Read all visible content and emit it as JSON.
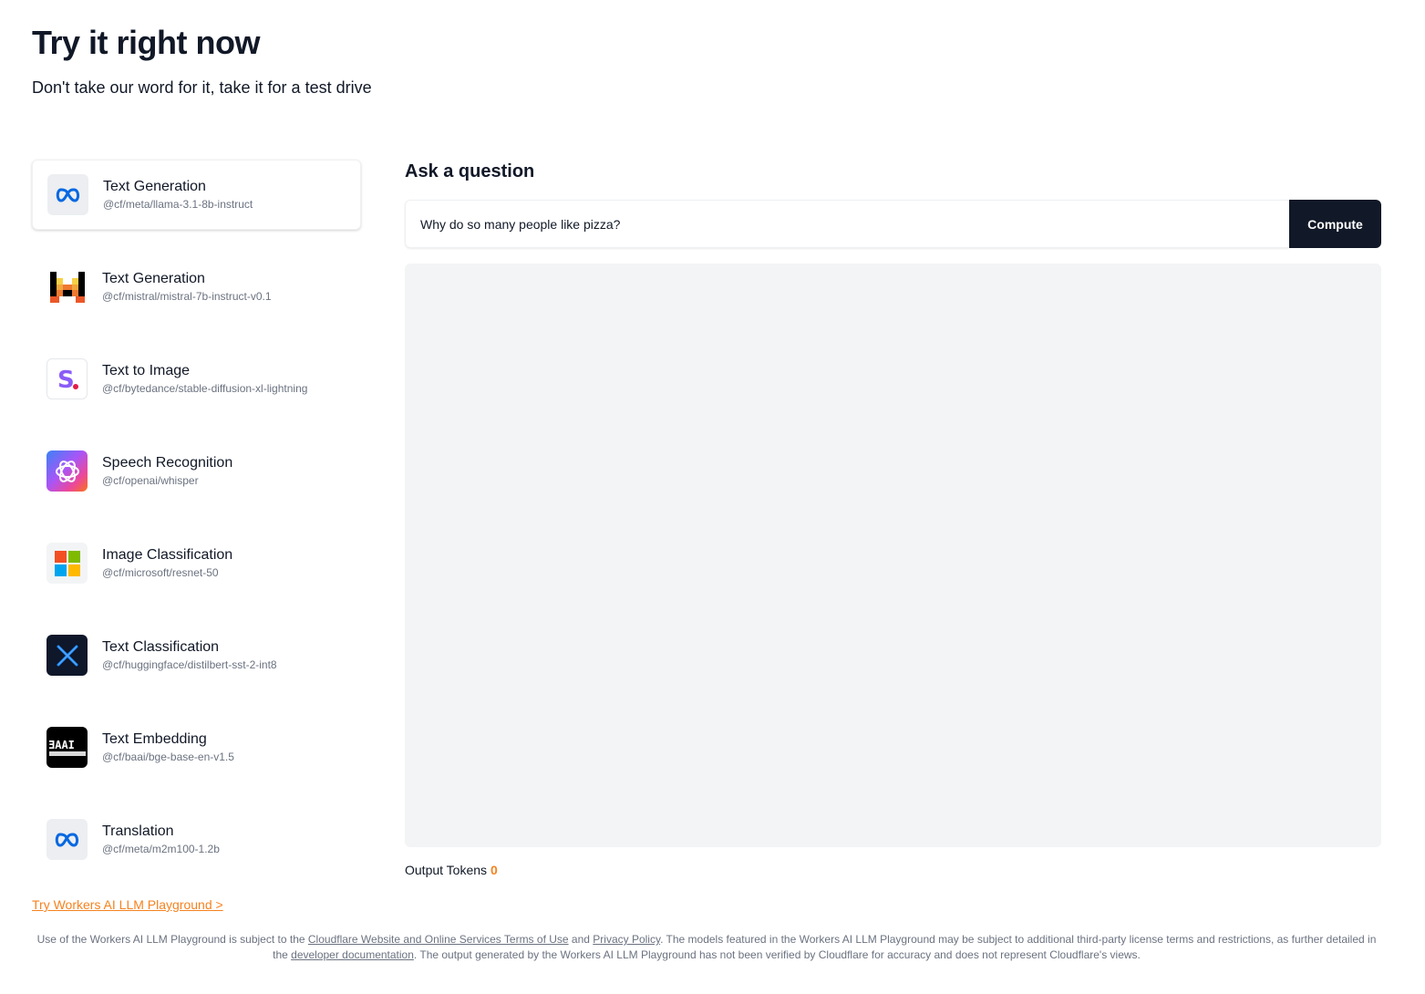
{
  "header": {
    "title": "Try it right now",
    "subtitle": "Don't take our word for it, take it for a test drive"
  },
  "models": [
    {
      "name": "Text Generation",
      "id": "@cf/meta/llama-3.1-8b-instruct",
      "icon": "meta-icon",
      "active": true
    },
    {
      "name": "Text Generation",
      "id": "@cf/mistral/mistral-7b-instruct-v0.1",
      "icon": "mistral-icon",
      "active": false
    },
    {
      "name": "Text to Image",
      "id": "@cf/bytedance/stable-diffusion-xl-lightning",
      "icon": "stability-icon",
      "active": false
    },
    {
      "name": "Speech Recognition",
      "id": "@cf/openai/whisper",
      "icon": "openai-icon",
      "active": false
    },
    {
      "name": "Image Classification",
      "id": "@cf/microsoft/resnet-50",
      "icon": "microsoft-icon",
      "active": false
    },
    {
      "name": "Text Classification",
      "id": "@cf/huggingface/distilbert-sst-2-int8",
      "icon": "huggingface-x-icon",
      "active": false
    },
    {
      "name": "Text Embedding",
      "id": "@cf/baai/bge-base-en-v1.5",
      "icon": "baai-icon",
      "active": false
    },
    {
      "name": "Translation",
      "id": "@cf/meta/m2m100-1.2b",
      "icon": "meta-icon",
      "active": false
    }
  ],
  "ask": {
    "title": "Ask a question",
    "input_value": "Why do so many people like pizza?",
    "button_label": "Compute"
  },
  "output": {
    "tokens_label": "Output Tokens",
    "tokens_count": "0"
  },
  "footer": {
    "link_text": "Try Workers AI LLM Playground >",
    "disclaimer_1": "Use of the Workers AI LLM Playground is subject to the ",
    "terms_link": "Cloudflare Website and Online Services Terms of Use",
    "disclaimer_2": " and ",
    "privacy_link": "Privacy Policy",
    "disclaimer_3": ". The models featured in the Workers AI LLM Playground may be subject to additional third-party license terms and restrictions, as further detailed in the ",
    "docs_link": "developer documentation",
    "disclaimer_4": ". The output generated by the Workers AI LLM Playground has not been verified by Cloudflare for accuracy and does not represent Cloudflare's views."
  },
  "colors": {
    "accent": "#f6821f",
    "dark": "#111827",
    "output_bg": "#f3f4f6"
  }
}
